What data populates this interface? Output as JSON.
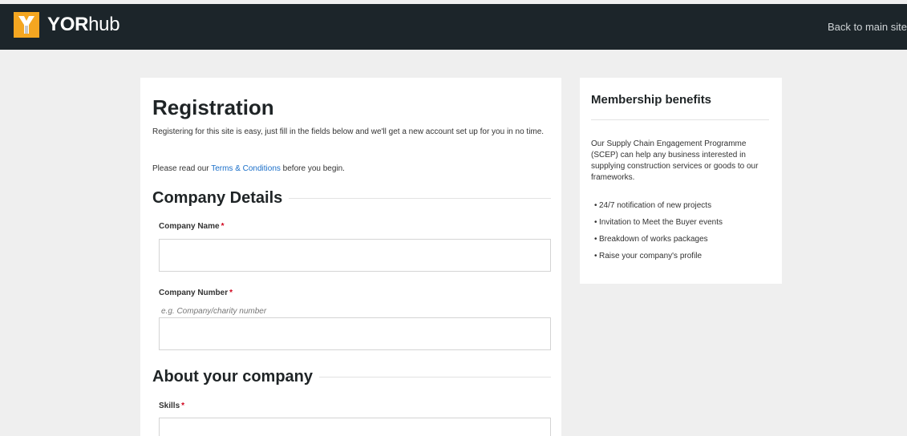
{
  "header": {
    "logo_letter": "Y",
    "logo_bold": "YOR",
    "logo_light": "hub",
    "back_link": "Back to main site",
    "colors": {
      "bar": "#1c252a",
      "accent": "#f4a621"
    }
  },
  "registration": {
    "title": "Registration",
    "intro": "Registering for this site is easy, just fill in the fields below and we'll get a new account set up for you in no time.",
    "terms_prefix": "Please read our ",
    "terms_link": "Terms & Conditions",
    "terms_suffix": " before you begin."
  },
  "company_details": {
    "heading": "Company Details",
    "company_name_label": "Company Name",
    "company_name_value": "",
    "company_number_label": "Company Number",
    "company_number_hint": "e.g. Company/charity number",
    "company_number_value": "",
    "required_marker": "*"
  },
  "about_company": {
    "heading": "About your company",
    "skills_label": "Skills",
    "skills_value": ""
  },
  "membership": {
    "title": "Membership benefits",
    "text": "Our Supply Chain Engagement Programme (SCEP) can help any business interested in supplying construction services or goods to our frameworks.",
    "benefits": [
      "24/7 notification of new projects",
      "Invitation to Meet the Buyer events",
      "Breakdown of works packages",
      "Raise your company's profile"
    ]
  }
}
